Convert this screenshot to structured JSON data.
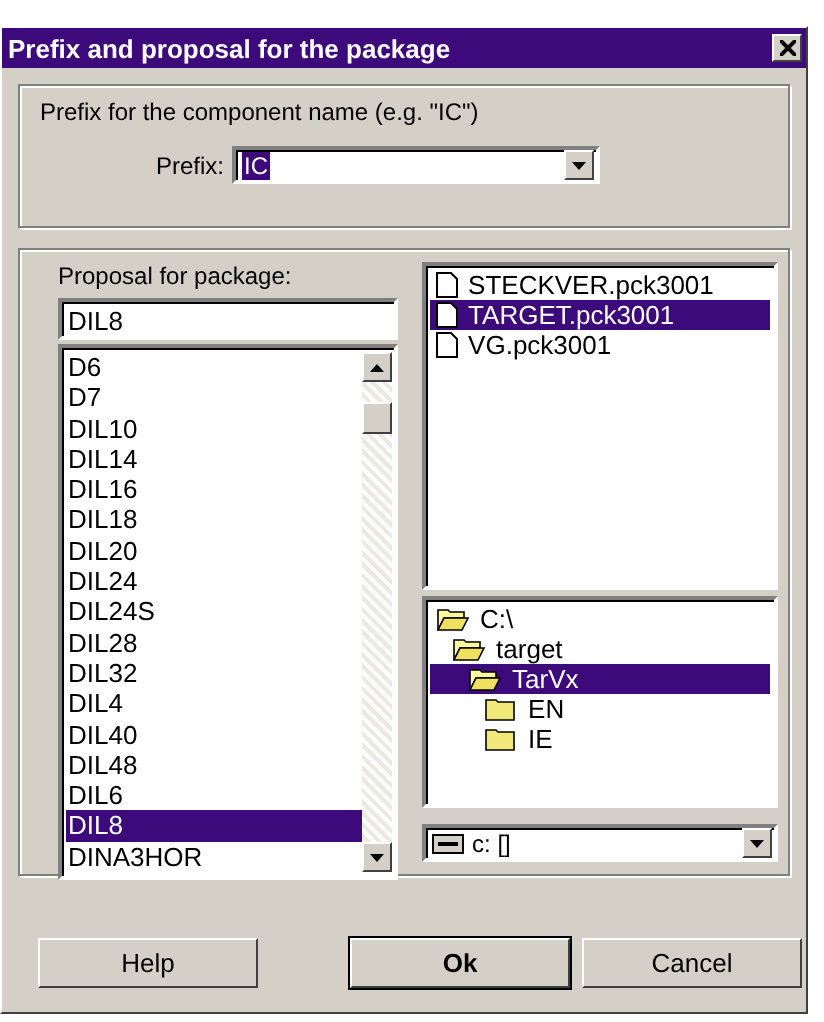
{
  "window": {
    "title": "Prefix and proposal for the package"
  },
  "prefix_group": {
    "label": "Prefix for the component name (e.g. \"IC\")",
    "field_label": "Prefix:",
    "value": "IC"
  },
  "package": {
    "label": "Proposal for package:",
    "value": "DIL8",
    "items": [
      {
        "label": "D6",
        "selected": false
      },
      {
        "label": "D7",
        "selected": false
      },
      {
        "label": "DIL10",
        "selected": false
      },
      {
        "label": "DIL14",
        "selected": false
      },
      {
        "label": "DIL16",
        "selected": false
      },
      {
        "label": "DIL18",
        "selected": false
      },
      {
        "label": "DIL20",
        "selected": false
      },
      {
        "label": "DIL24",
        "selected": false
      },
      {
        "label": "DIL24S",
        "selected": false
      },
      {
        "label": "DIL28",
        "selected": false
      },
      {
        "label": "DIL32",
        "selected": false
      },
      {
        "label": "DIL4",
        "selected": false
      },
      {
        "label": "DIL40",
        "selected": false
      },
      {
        "label": "DIL48",
        "selected": false
      },
      {
        "label": "DIL6",
        "selected": false
      },
      {
        "label": "DIL8",
        "selected": true
      },
      {
        "label": "DINA3HOR",
        "selected": false
      }
    ]
  },
  "files": [
    {
      "label": "STECKVER.pck3001",
      "selected": false
    },
    {
      "label": "TARGET.pck3001",
      "selected": true
    },
    {
      "label": "VG.pck3001",
      "selected": false
    }
  ],
  "folders": [
    {
      "label": "C:\\",
      "expanded": true,
      "selected": false,
      "children": [
        {
          "label": "target",
          "expanded": true,
          "selected": false,
          "children": [
            {
              "label": "TarVx",
              "expanded": true,
              "selected": true,
              "children": [
                {
                  "label": "EN",
                  "expanded": false,
                  "selected": false
                },
                {
                  "label": "IE",
                  "expanded": false,
                  "selected": false
                }
              ]
            }
          ]
        }
      ]
    }
  ],
  "drive": {
    "value": "c: []"
  },
  "buttons": [
    {
      "label": "Help",
      "default": false
    },
    {
      "label": "Ok",
      "default": true
    },
    {
      "label": "Cancel",
      "default": false
    }
  ]
}
